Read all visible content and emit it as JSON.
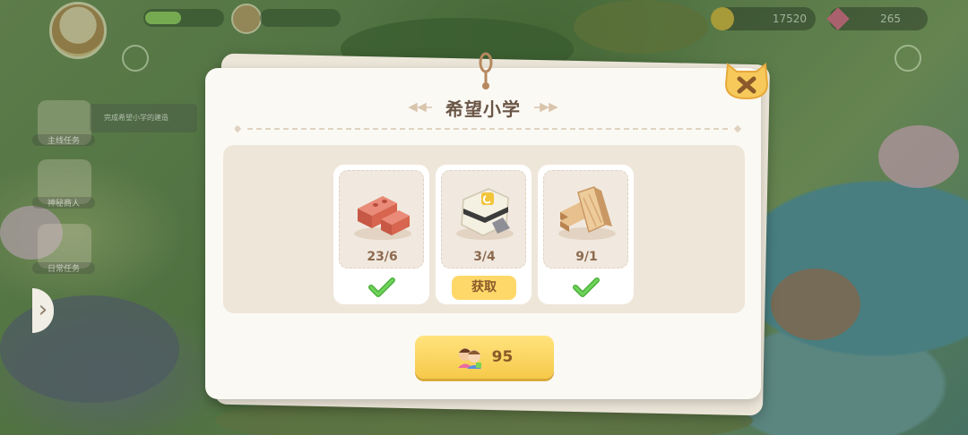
{
  "hud": {
    "coins": "17520",
    "gems": "265"
  },
  "side_menu": [
    {
      "label": "主线任务"
    },
    {
      "label": "神秘商人"
    },
    {
      "label": "日常任务"
    }
  ],
  "task_banner": "完成希望小学的建造",
  "dialog": {
    "title": "希望小学",
    "materials": [
      {
        "icon": "brick-icon",
        "count": "23/6",
        "status": "complete"
      },
      {
        "icon": "cement-bag-icon",
        "count": "3/4",
        "status": "insufficient",
        "action_label": "获取"
      },
      {
        "icon": "wood-planks-icon",
        "count": "9/1",
        "status": "complete"
      }
    ],
    "build_button": {
      "icon": "workers-icon",
      "value": "95"
    }
  },
  "colors": {
    "panel_bg": "#fbf9f4",
    "accent_yellow": "#ffd86a",
    "check_green": "#5cc94a",
    "title_brown": "#6a5646"
  }
}
